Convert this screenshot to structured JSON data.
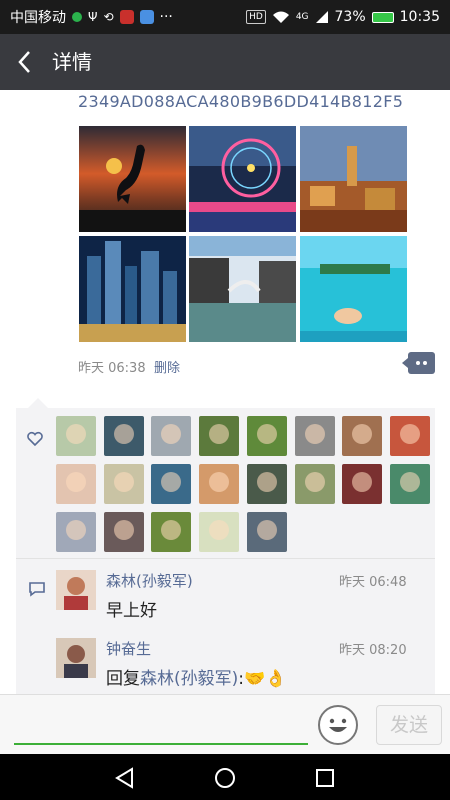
{
  "status_bar": {
    "carrier": "中国移动",
    "hd": "HD",
    "network": "4G",
    "battery": "73%",
    "time": "10:35"
  },
  "header": {
    "title": "详情",
    "back_icon": "chevron-left-icon"
  },
  "post": {
    "hash_text": "2349AD088ACA480B9B6DD414B812F5",
    "photos": [
      {
        "name": "photo-crane-sunset"
      },
      {
        "name": "photo-ferris-wheel"
      },
      {
        "name": "photo-old-town"
      },
      {
        "name": "photo-city-night"
      },
      {
        "name": "photo-water-town"
      },
      {
        "name": "photo-tropical-lagoon"
      }
    ],
    "time": "昨天 06:38",
    "delete_label": "删除"
  },
  "likes": {
    "icon": "heart-icon",
    "avatars": [
      {
        "color": "#b7c9a8"
      },
      {
        "color": "#3d5a6a"
      },
      {
        "color": "#9fa8b0"
      },
      {
        "color": "#5c7a3c"
      },
      {
        "color": "#5f8a3a"
      },
      {
        "color": "#8a8a8a"
      },
      {
        "color": "#a07050"
      },
      {
        "color": "#c7563d"
      },
      {
        "color": "#e3c4b0"
      },
      {
        "color": "#c9c3a4"
      },
      {
        "color": "#3a6a8a"
      },
      {
        "color": "#d49a6a"
      },
      {
        "color": "#4a5a4a"
      },
      {
        "color": "#8a9a6a"
      },
      {
        "color": "#7a3030"
      },
      {
        "color": "#4a8a6a"
      },
      {
        "color": "#a0a8b8"
      },
      {
        "color": "#6a5a5a"
      },
      {
        "color": "#6a8a3a"
      },
      {
        "color": "#d8e0c0"
      },
      {
        "color": "#5a6a7a"
      }
    ]
  },
  "comments": {
    "icon": "comment-icon",
    "items": [
      {
        "author": "森林(孙毅军)",
        "time": "昨天 06:48",
        "text": "早上好",
        "avatar_color": "#b86a4a"
      },
      {
        "author": "钟奋生",
        "time": "昨天 08:20",
        "reply_prefix": "回复",
        "reply_to": "森林(孙毅军)",
        "reply_suffix": ":",
        "emojis": "🤝👌",
        "avatar_color": "#6a4a3a"
      }
    ]
  },
  "input_bar": {
    "emoji_icon": "smiley-icon",
    "send_label": "发送"
  },
  "nav_bar": {
    "back": "nav-back-icon",
    "home": "nav-home-icon",
    "recent": "nav-recent-icon"
  },
  "colors": {
    "link": "#576b95",
    "title_bar": "#393a3f",
    "status_bar": "#1b1b1b",
    "accent_green": "#3caf37"
  }
}
